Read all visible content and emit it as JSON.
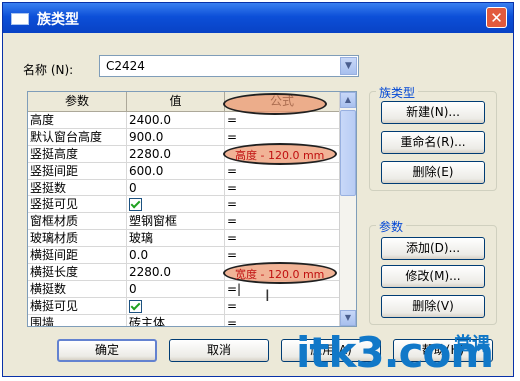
{
  "window": {
    "title": "族类型",
    "close_glyph": "✕"
  },
  "name_field": {
    "label": "名称 (N):",
    "value": "C2424"
  },
  "grid": {
    "columns": [
      "参数",
      "值",
      "公式"
    ],
    "rows": [
      {
        "param": "高度",
        "value": "2400.0",
        "formula": "="
      },
      {
        "param": "默认窗台高度",
        "value": "900.0",
        "formula": "="
      },
      {
        "param": "竖挺高度",
        "value": "2280.0",
        "formula": ""
      },
      {
        "param": "竖挺间距",
        "value": "600.0",
        "formula": "="
      },
      {
        "param": "竖挺数",
        "value": "0",
        "formula": "="
      },
      {
        "param": "竖挺可见",
        "value": "",
        "checked": true,
        "formula": "="
      },
      {
        "param": "窗框材质",
        "value": "塑钢窗框",
        "formula": "="
      },
      {
        "param": "玻璃材质",
        "value": "玻璃",
        "formula": "="
      },
      {
        "param": "横挺间距",
        "value": "0.0",
        "formula": "="
      },
      {
        "param": "横挺长度",
        "value": "2280.0",
        "formula": ""
      },
      {
        "param": "横挺数",
        "value": "0",
        "formula": "=|"
      },
      {
        "param": "横挺可见",
        "value": "",
        "checked": true,
        "formula": "="
      },
      {
        "param": "围墙",
        "value": "砖主体",
        "formula": "="
      }
    ],
    "highlight_formula_1": "高度 - 120.0 mm",
    "highlight_formula_2": "宽度 - 120.0 mm"
  },
  "family_types_group": {
    "title": "族类型",
    "new_button": "新建(N)...",
    "rename_button": "重命名(R)...",
    "delete_button": "删除(E)"
  },
  "parameters_group": {
    "title": "参数",
    "add_button": "添加(D)...",
    "modify_button": "修改(M)...",
    "delete_button": "删除(V)"
  },
  "footer": {
    "ok_button": "确定",
    "cancel_button": "取消",
    "apply_button": "应用(A)",
    "help_button": "帮助(H)"
  },
  "watermark": {
    "text": "itk3.com",
    "sub": "堂课"
  },
  "colors": {
    "title_bar": "#0c4fd8",
    "highlight": "#ec966e",
    "watermark": "#1178c8"
  },
  "icons": [
    "window-icon",
    "close-icon",
    "chevron-down-icon",
    "checkbox-icon",
    "scroll-up-icon",
    "scroll-down-icon",
    "text-cursor-icon"
  ]
}
